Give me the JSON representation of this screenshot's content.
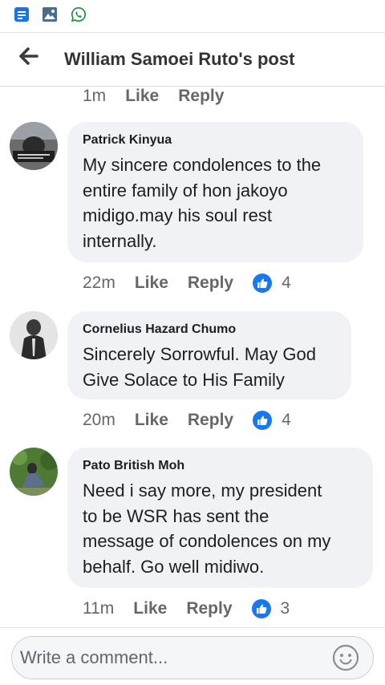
{
  "header": {
    "title": "William Samoei Ruto's post"
  },
  "previous_comment": {
    "time": "1m",
    "like_label": "Like",
    "reply_label": "Reply"
  },
  "comments": [
    {
      "author": "Patrick Kinyua",
      "lines": [
        "My sincere condolences to the",
        "entire family of hon jakoyo",
        "midigo.may his soul rest",
        "internally."
      ],
      "time": "22m",
      "like_label": "Like",
      "reply_label": "Reply",
      "reactions": "4"
    },
    {
      "author": "Cornelius Hazard Chumo",
      "lines": [
        "Sincerely Sorrowful. May God",
        "Give Solace to His Family"
      ],
      "time": "20m",
      "like_label": "Like",
      "reply_label": "Reply",
      "reactions": "4"
    },
    {
      "author": "Pato British Moh",
      "lines": [
        "Need i say more, my president",
        "to be WSR has sent the",
        "message of condolences on my",
        "behalf. Go well midiwo."
      ],
      "time": "11m",
      "like_label": "Like",
      "reply_label": "Reply",
      "reactions": "3"
    }
  ],
  "composer": {
    "placeholder": "Write a comment..."
  },
  "status_icons": [
    "document-icon",
    "gallery-icon",
    "whatsapp-icon"
  ],
  "colors": {
    "like_blue": "#1877f2",
    "bubble_bg": "#f0f2f5",
    "meta_gray": "#65676b",
    "whatsapp_green": "#25d366"
  }
}
